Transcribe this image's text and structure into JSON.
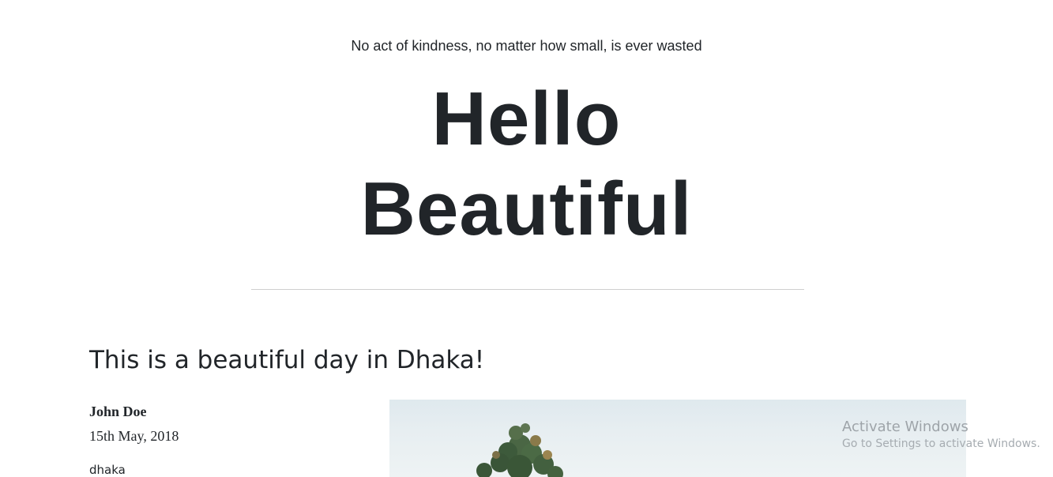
{
  "hero": {
    "tagline": "No act of kindness, no matter how small, is ever wasted",
    "title_line1": "Hello",
    "title_line2": "Beautiful"
  },
  "post": {
    "title": "This is a beautiful day in Dhaka!",
    "author": "John Doe",
    "date": "15th May, 2018",
    "location": "dhaka"
  },
  "watermark": {
    "title": "Activate Windows",
    "subtitle": "Go to Settings to activate Windows."
  }
}
